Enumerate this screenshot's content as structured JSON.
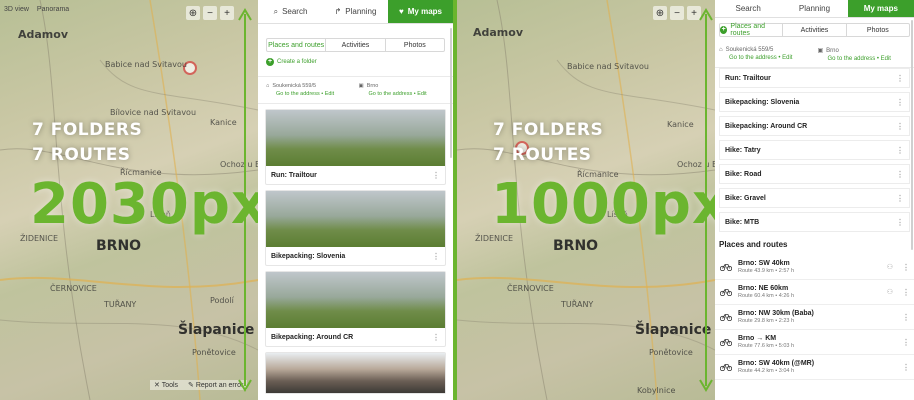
{
  "accent": "#3c9f2b",
  "highlight": "#6bb52f",
  "left": {
    "map": {
      "controls": [
        "3D view",
        "Panorama"
      ],
      "zoom": [
        "⊕",
        "−",
        "+"
      ],
      "places": [
        "Adamov",
        "Babice nad Svitavou",
        "Kanice",
        "Řícmanice",
        "Ochoz u Brna",
        "Bílovice nad Svitavou",
        "Líšeň",
        "ŽIDENICE",
        "BRNO",
        "ČERNOVICE",
        "TUŘANY",
        "Šlapanice",
        "Ponětovice",
        "Podolí"
      ],
      "footer": [
        "Tools",
        "Report an error"
      ]
    },
    "overlay": {
      "line1": "7 FOLDERS",
      "line2": "7 ROUTES",
      "size": "2030px"
    },
    "panel": {
      "tabs": [
        "Search",
        "Planning",
        "My maps"
      ],
      "segments": [
        "Places and routes",
        "Activities",
        "Photos"
      ],
      "create_folder": "Create a folder",
      "addresses": [
        {
          "name": "Soukenická 559/5",
          "links": "Go to the address • Edit"
        },
        {
          "name": "Brno",
          "links": "Go to the address • Edit"
        }
      ],
      "cards": [
        "Run: Trailtour",
        "Bikepacking: Slovenia",
        "Bikepacking: Around CR"
      ]
    }
  },
  "right": {
    "map": {
      "zoom": [
        "⊕",
        "−",
        "+"
      ],
      "places": [
        "Adamov",
        "Babice nad Svitavou",
        "Kanice",
        "Řícmanice",
        "Ochoz u Brna",
        "Líšeň",
        "ŽIDENICE",
        "BRNO",
        "ČERNOVICE",
        "TUŘANY",
        "Šlapanice",
        "Ponětovice",
        "Kobylnice"
      ]
    },
    "overlay": {
      "line1": "7 FOLDERS",
      "line2": "7 ROUTES",
      "size": "1000px"
    },
    "panel": {
      "tabs": [
        "Search",
        "Planning",
        "My maps"
      ],
      "segments": [
        "Places and routes",
        "Activities",
        "Photos"
      ],
      "addresses": [
        {
          "name": "Soukenická 559/5",
          "links": "Go to the address • Edit"
        },
        {
          "name": "Brno",
          "links": "Go to the address • Edit"
        }
      ],
      "folders": [
        "Run: Trailtour",
        "Bikepacking: Slovenia",
        "Bikepacking: Around CR",
        "Hike: Tatry",
        "Bike: Road",
        "Bike: Gravel",
        "Bike: MTB"
      ],
      "section_title": "Places and routes",
      "routes": [
        {
          "name": "Brno: SW 40km",
          "meta": "Route 43.9 km • 2:57 h"
        },
        {
          "name": "Brno: NE 60km",
          "meta": "Route 60.4 km • 4:26 h"
        },
        {
          "name": "Brno: NW 30km (Baba)",
          "meta": "Route 29.8 km • 2:23 h"
        },
        {
          "name": "Brno → KM",
          "meta": "Route 77.6 km • 5:03 h"
        },
        {
          "name": "Brno: SW 40km (@MR)",
          "meta": "Route 44.2 km • 3:04 h"
        }
      ]
    }
  }
}
